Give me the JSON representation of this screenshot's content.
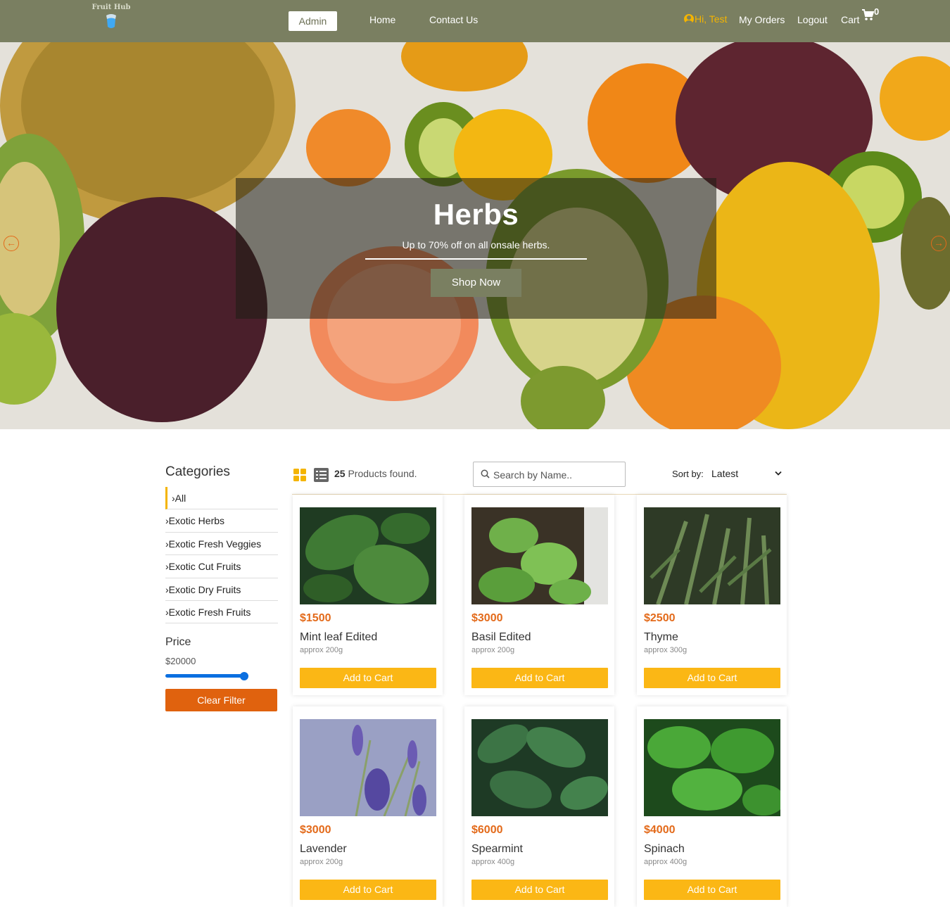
{
  "navbar": {
    "logo_text": "Fruit Hub",
    "admin_label": "Admin",
    "home_label": "Home",
    "contact_label": "Contact Us",
    "greeting": "Hi, Test",
    "orders_label": "My Orders",
    "logout_label": "Logout",
    "cart_label": "Cart",
    "cart_count": "0",
    "colors": {
      "bar": "#7a7f61",
      "greeting": "#f4b400"
    }
  },
  "hero": {
    "title": "Herbs",
    "subtitle": "Up to 70% off on all onsale herbs.",
    "button_label": "Shop Now",
    "prev_icon": "arrow-left-icon",
    "next_icon": "arrow-right-icon"
  },
  "sidebar": {
    "categories_title": "Categories",
    "categories": [
      {
        "label": "›All"
      },
      {
        "label": "›Exotic Herbs"
      },
      {
        "label": "›Exotic Fresh Veggies"
      },
      {
        "label": "›Exotic Cut Fruits"
      },
      {
        "label": "›Exotic Dry Fruits"
      },
      {
        "label": "›Exotic Fresh Fruits"
      }
    ],
    "active_category": "›All",
    "price_title": "Price",
    "price_value": "$20000",
    "price_slider_level": 1.0,
    "clear_label": "Clear Filter"
  },
  "toolbar": {
    "grid_icon": "grid-view-icon",
    "list_icon": "list-view-icon",
    "count": "25",
    "found_text": "Products found.",
    "search_placeholder": "Search by Name..",
    "sort_label": "Sort by:",
    "sort_value": "Latest"
  },
  "products": [
    {
      "price": "$1500",
      "name": "Mint leaf Edited",
      "weight": "approx 200g",
      "button": "Add to Cart",
      "image": "mint-leaf-photo"
    },
    {
      "price": "$3000",
      "name": "Basil Edited",
      "weight": "approx 200g",
      "button": "Add to Cart",
      "image": "basil-photo"
    },
    {
      "price": "$2500",
      "name": "Thyme",
      "weight": "approx 300g",
      "button": "Add to Cart",
      "image": "thyme-photo"
    },
    {
      "price": "$3000",
      "name": "Lavender",
      "weight": "approx 200g",
      "button": "Add to Cart",
      "image": "lavender-photo"
    },
    {
      "price": "$6000",
      "name": "Spearmint",
      "weight": "approx 400g",
      "button": "Add to Cart",
      "image": "spearmint-photo"
    },
    {
      "price": "$4000",
      "name": "Spinach",
      "weight": "approx 400g",
      "button": "Add to Cart",
      "image": "spinach-photo"
    }
  ],
  "colors": {
    "price": "#e36a1a",
    "add_button": "#fbb715",
    "clear_button": "#e0620e",
    "slider": "#0b6fe0"
  }
}
